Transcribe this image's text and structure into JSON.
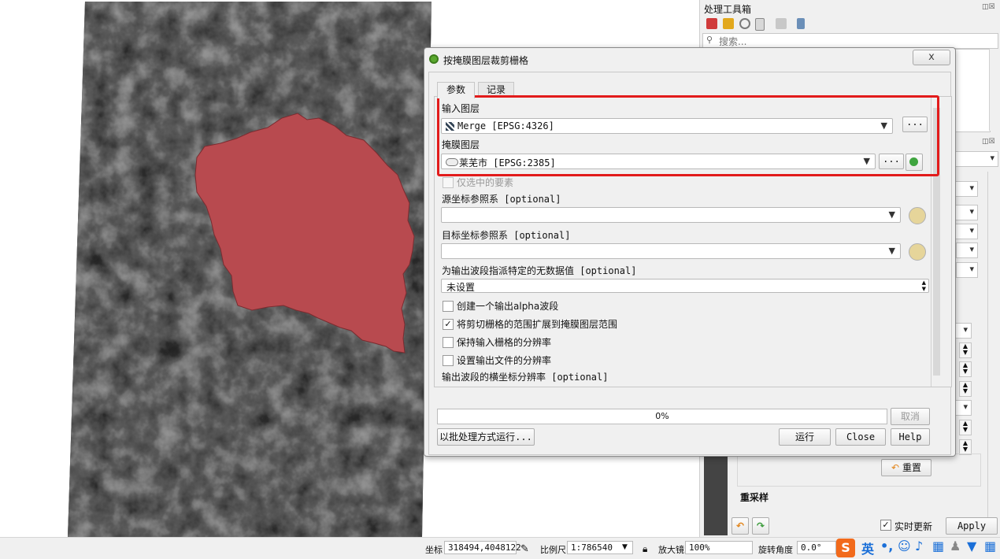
{
  "dock": {
    "toolbox_title": "处理工具箱",
    "search_placeholder": "搜索...",
    "reset_label": "重置",
    "resample_label": "重采样",
    "live_update_label": "实时更新",
    "apply_label": "Apply",
    "float_close_icons": "◫☒"
  },
  "dialog": {
    "title": "按掩膜图层裁剪栅格",
    "close_glyph": "ⅹ",
    "tabs": {
      "params": "参数",
      "log": "记录"
    },
    "input_layer_label": "输入图层",
    "input_layer_value": "Merge [EPSG:4326]",
    "mask_layer_label": "掩膜图层",
    "mask_layer_value": "莱芜市 [EPSG:2385]",
    "selected_only_label": "仅选中的要素",
    "source_crs_label": "源坐标参照系 [optional]",
    "target_crs_label": "目标坐标参照系 [optional]",
    "nodata_label": "为输出波段指派特定的无数据值 [optional]",
    "nodata_value": "未设置",
    "alpha_label": "创建一个输出alpha波段",
    "crop_label": "将剪切栅格的范围扩展到掩膜图层范围",
    "keep_res_label": "保持输入栅格的分辨率",
    "set_res_label": "设置输出文件的分辨率",
    "x_res_label": "输出波段的横坐标分辨率 [optional]",
    "dots": "...",
    "progress_text": "0%",
    "cancel_label": "取消",
    "batch_label": "以批处理方式运行...",
    "run_label": "运行",
    "close_label": "Close",
    "help_label": "Help",
    "checkmark": "✓"
  },
  "statusbar": {
    "coord_label": "坐标",
    "coord_value": "318494,4048122",
    "scale_label": "比例尺",
    "scale_value": "1:786540",
    "magnifier_label": "放大镜",
    "magnifier_value": "100%",
    "rotation_label": "旋转角度",
    "rotation_value": "0.0°",
    "ime_lang": "英"
  },
  "colors": {
    "mask_polygon": "#b84a4f",
    "highlight": "#e21b1b",
    "qgis_green": "#5aa82f"
  }
}
